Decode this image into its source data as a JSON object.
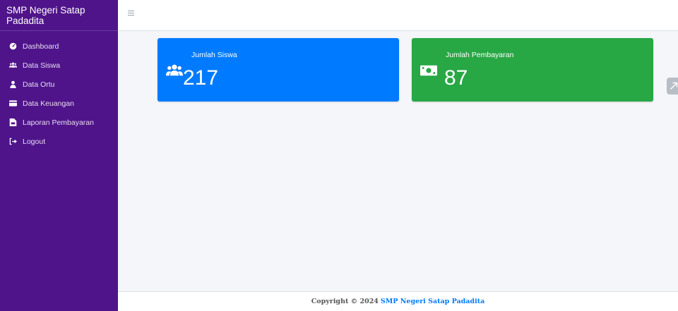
{
  "brand": {
    "title": "SMP Negeri Satap Padadita"
  },
  "sidebar": {
    "items": [
      {
        "label": "Dashboard",
        "icon": "dashboard-icon"
      },
      {
        "label": "Data Siswa",
        "icon": "users-icon"
      },
      {
        "label": "Data Ortu",
        "icon": "user-icon"
      },
      {
        "label": "Data Keuangan",
        "icon": "credit-card-icon"
      },
      {
        "label": "Laporan Pembayaran",
        "icon": "file-invoice-icon"
      },
      {
        "label": "Logout",
        "icon": "sign-out-icon"
      }
    ]
  },
  "cards": {
    "siswa": {
      "title": "Jumlah Siswa",
      "value": "217",
      "color": "#007bff",
      "icon": "users-icon"
    },
    "bayar": {
      "title": "Jumlah Pembayaran",
      "value": "87",
      "color": "#28a745",
      "icon": "money-bill-icon"
    }
  },
  "footer": {
    "prefix": "Copyright © 2024",
    "link": "SMP Negeri Satap Padadita"
  },
  "colors": {
    "sidebar": "#4f148a",
    "background": "#f4f6f9",
    "accent": "#007bff"
  }
}
